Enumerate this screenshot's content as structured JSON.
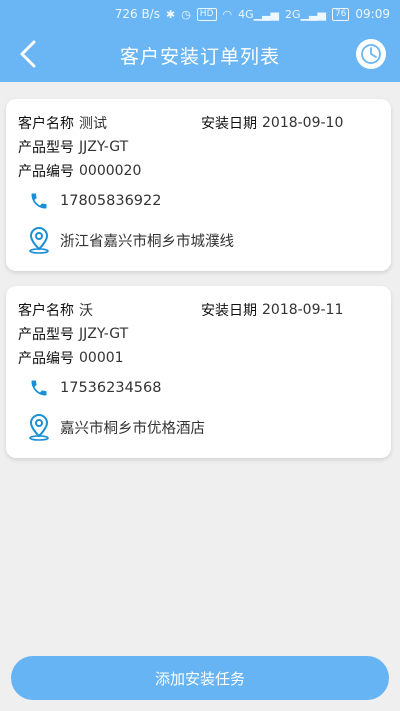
{
  "status_bar": {
    "network_speed": "726 B/s",
    "hd": "HD",
    "signal1": "4G",
    "signal2": "2G",
    "battery": "76",
    "time": "09:09"
  },
  "header": {
    "title": "客户安装订单列表"
  },
  "labels": {
    "customer_name": "客户名称",
    "install_date": "安装日期",
    "product_model": "产品型号",
    "product_code": "产品编号"
  },
  "orders": [
    {
      "customer_name": "测试",
      "install_date": "2018-09-10",
      "product_model": "JJZY-GT",
      "product_code": "0000020",
      "phone": "17805836922",
      "address": "浙江省嘉兴市桐乡市城濮线"
    },
    {
      "customer_name": "沃",
      "install_date": "2018-09-11",
      "product_model": "JJZY-GT",
      "product_code": "00001",
      "phone": "17536234568",
      "address": "嘉兴市桐乡市优格酒店"
    }
  ],
  "add_button": {
    "label": "添加安装任务"
  },
  "colors": {
    "header": "#6ab6f5",
    "icon_blue": "#1a8fd6",
    "button": "#66b4f4"
  }
}
